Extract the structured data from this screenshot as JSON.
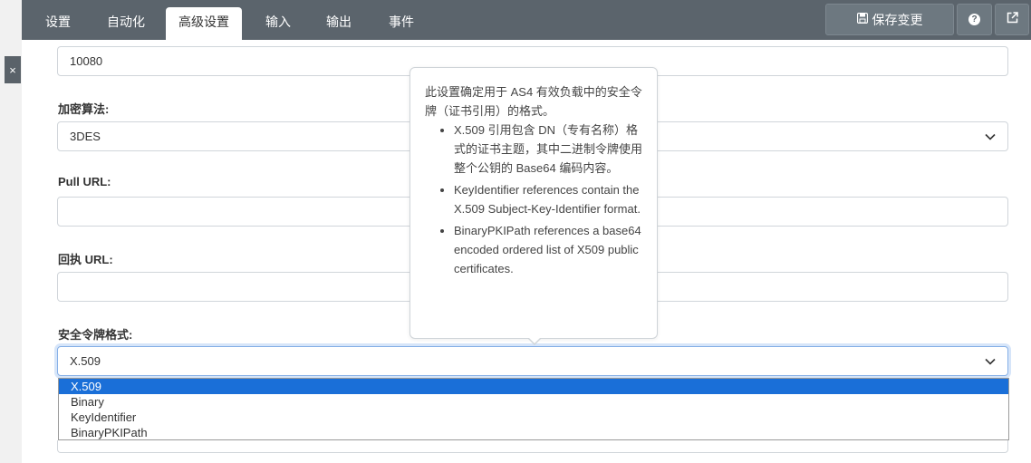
{
  "header": {
    "tabs": [
      {
        "label": "设置",
        "active": false
      },
      {
        "label": "自动化",
        "active": false
      },
      {
        "label": "高级设置",
        "active": true
      },
      {
        "label": "输入",
        "active": false
      },
      {
        "label": "输出",
        "active": false
      },
      {
        "label": "事件",
        "active": false
      }
    ],
    "save_label": "保存变更",
    "save_icon": "floppy-disk-icon",
    "help_icon": "question-circle-icon",
    "external_icon": "external-link-icon"
  },
  "side": {
    "close_glyph": "×"
  },
  "form": {
    "top_field_value": "10080",
    "encryption_label": "加密算法:",
    "encryption_value": "3DES",
    "pull_url_label": "Pull URL:",
    "pull_url_value": "",
    "receipt_url_label": "回执 URL:",
    "receipt_url_value": "",
    "token_format_label": "安全令牌格式:",
    "token_format_value": "X.509",
    "token_format_options": [
      "X.509",
      "Binary",
      "KeyIdentifier",
      "BinaryPKIPath"
    ]
  },
  "tooltip": {
    "intro": "此设置确定用于 AS4 有效负载中的安全令牌（证书引用）的格式。",
    "items": [
      "X.509 引用包含 DN（专有名称）格式的证书主题，其中二进制令牌使用整个公钥的 Base64 编码内容。",
      "KeyIdentifier references contain the X.509 Subject-Key-Identifier format.",
      "BinaryPKIPath references a base64 encoded ordered list of X509 public certificates."
    ]
  },
  "colors": {
    "header_bg": "#5b646c",
    "selected_option": "#1a6fd8",
    "focus_border": "#86b0e7"
  }
}
